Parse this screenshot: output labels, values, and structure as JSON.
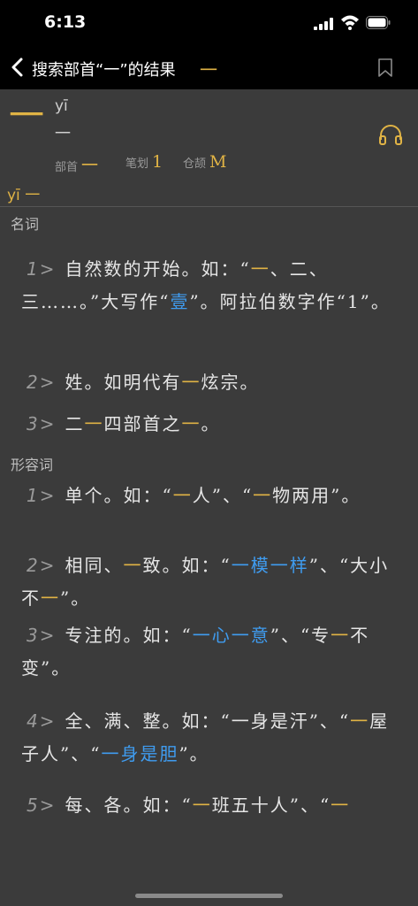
{
  "status": {
    "time": "6:13"
  },
  "nav": {
    "title": "搜索部首“一”的结果",
    "title_char": "一"
  },
  "header": {
    "char": "一",
    "pinyin": "yī",
    "trad": "一",
    "bushou_label": "部首",
    "bushou": "一",
    "bihua_label": "笔划",
    "bihua": "1",
    "cangjie_label": "仓颉",
    "cangjie": "M",
    "pinyin_line": "yī 一"
  },
  "sections": {
    "noun": "名词",
    "adj": "形容词"
  },
  "noun_entries": [
    {
      "num": "1>",
      "p1": "自然数的开始。如：“",
      "h1": "一",
      "p2": "、二、三……。”大写作“",
      "h2": "壹",
      "p3": "”。阿拉伯数字作“1”。"
    },
    {
      "num": "2>",
      "p1": "姓。如明代有",
      "h1": "一",
      "p2": "炫宗。"
    },
    {
      "num": "3>",
      "p1": "二",
      "h1": "一",
      "p2": "四部首之",
      "h2": "一",
      "p3": "。"
    }
  ],
  "adj_entries": [
    {
      "num": "1>",
      "p1": "单个。如：“",
      "h1": "一",
      "p2": "人”、“",
      "h2": "一",
      "p3": "物两用”。"
    },
    {
      "num": "2>",
      "p1": "相同、",
      "h1": "一",
      "p2": "致。如：“",
      "h2": "一模一样",
      "p3": "”、“大小不",
      "h3": "一",
      "p4": "”。"
    },
    {
      "num": "3>",
      "p1": "专注的。如：“",
      "h1": "一心一意",
      "p2": "”、“专",
      "h2": "一",
      "p3": "不变”。"
    },
    {
      "num": "4>",
      "p1": "全、满、整。如：“一身是汗”、“",
      "h1": "一",
      "p2": "屋子人”、“",
      "h2": "一身是胆",
      "p3": "”。"
    },
    {
      "num": "5>",
      "p1": "每、各。如：“",
      "h1": "一",
      "p2": "班五十人”、“",
      "h2": "一"
    }
  ],
  "colors": {
    "accent": "#e0b345",
    "link": "#3f9cf0",
    "background": "#3b3b3b",
    "bar": "#000000"
  }
}
